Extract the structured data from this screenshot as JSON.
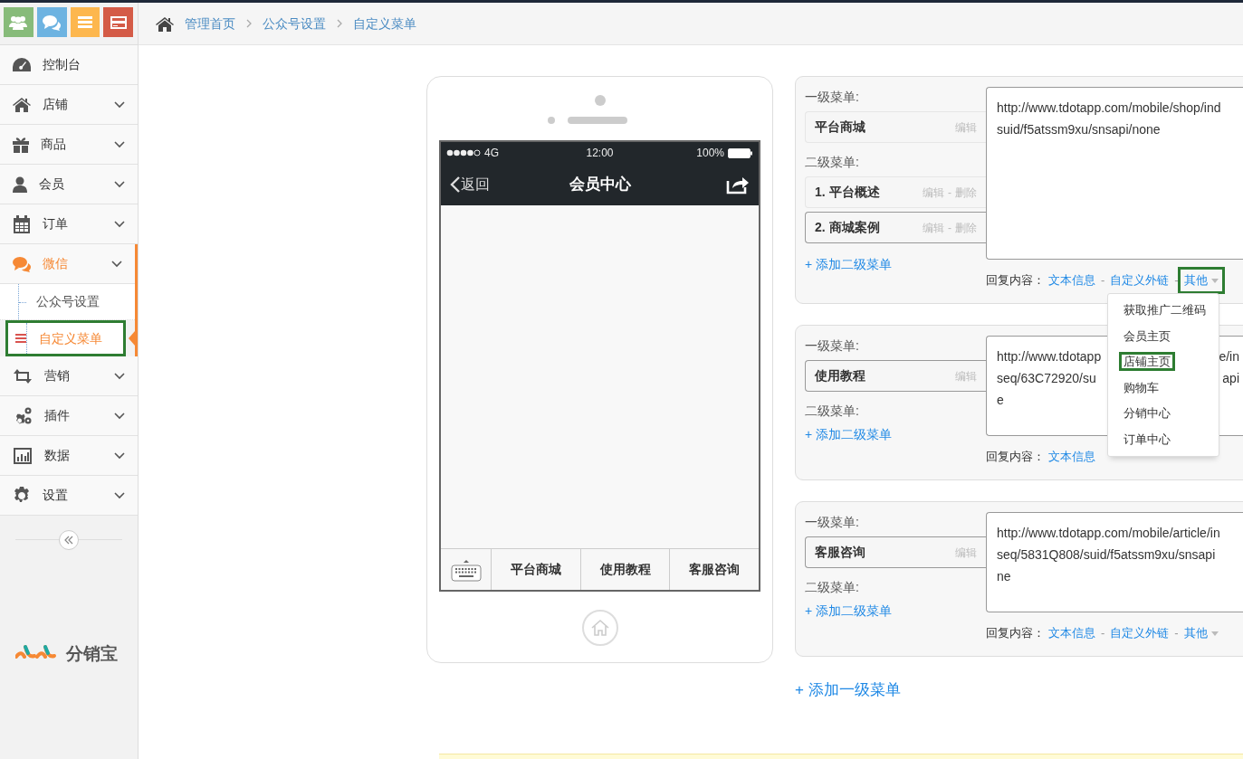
{
  "top_buttons": [
    {
      "color": "#87bb7a"
    },
    {
      "color": "#6db3e1"
    },
    {
      "color": "#fdb74e"
    },
    {
      "color": "#d45b47"
    }
  ],
  "breadcrumb": [
    {
      "label": "管理首页"
    },
    {
      "label": "公众号设置"
    },
    {
      "label": "自定义菜单"
    }
  ],
  "sidebar": {
    "items": [
      {
        "label": "控制台",
        "expandable": false,
        "selected": false
      },
      {
        "label": "店铺",
        "expandable": true,
        "selected": false
      },
      {
        "label": "商品",
        "expandable": true,
        "selected": false
      },
      {
        "label": "会员",
        "expandable": true,
        "selected": false
      },
      {
        "label": "订单",
        "expandable": true,
        "selected": false
      },
      {
        "label": "微信",
        "expandable": true,
        "selected": true,
        "children": [
          {
            "label": "公众号设置",
            "selected": false,
            "highlighted": false
          },
          {
            "label": "自定义菜单",
            "selected": true,
            "highlighted": true
          }
        ]
      },
      {
        "label": "营销",
        "expandable": true,
        "selected": false
      },
      {
        "label": "插件",
        "expandable": true,
        "selected": false
      },
      {
        "label": "数据",
        "expandable": true,
        "selected": false
      },
      {
        "label": "设置",
        "expandable": true,
        "selected": false
      }
    ],
    "brand": "分销宝"
  },
  "phone": {
    "carrier": "4G",
    "time": "12:00",
    "battery": "100%",
    "back": "返回",
    "title": "会员中心",
    "menu": [
      {
        "label": "平台商城"
      },
      {
        "label": "使用教程"
      },
      {
        "label": "客服咨询"
      }
    ]
  },
  "panels": [
    {
      "level1_label": "一级菜单:",
      "level1": {
        "name": "平台商城",
        "edit": "编辑",
        "selected": false
      },
      "level2_label": "二级菜单:",
      "level2": [
        {
          "name": "1. 平台概述",
          "edit": "编辑",
          "separator": "-",
          "delete": "删除",
          "selected": false
        },
        {
          "name": "2. 商城案例",
          "edit": "编辑",
          "separator": "-",
          "delete": "删除",
          "selected": true
        }
      ],
      "add_level2": "+ 添加二级菜单",
      "content": [
        [
          "http://www.tdotapp.com/mobile/shop/ind"
        ],
        [
          "suid/f5atssm9xu/snsapi/none"
        ]
      ],
      "reply_label": "回复内容：",
      "reply_links": [
        {
          "label": "文本信息",
          "caret": false,
          "highlighted": false,
          "separator": "-"
        },
        {
          "label": "自定义外链",
          "caret": false,
          "highlighted": false,
          "separator": "-"
        },
        {
          "label": "其他",
          "caret": true,
          "highlighted": true,
          "open": true
        }
      ],
      "dropdown": [
        {
          "label": "获取推广二维码",
          "highlighted": false
        },
        {
          "label": "会员主页",
          "highlighted": false
        },
        {
          "label": "店铺主页",
          "highlighted": true
        },
        {
          "label": "购物车",
          "highlighted": false
        },
        {
          "label": "分销中心",
          "highlighted": false
        },
        {
          "label": "订单中心",
          "highlighted": false
        }
      ]
    },
    {
      "level1_label": "一级菜单:",
      "level1": {
        "name": "使用教程",
        "edit": "编辑",
        "selected": true
      },
      "level2_label": "二级菜单:",
      "add_level2": "+ 添加二级菜单",
      "content": [
        [
          "http://www.tdotapp",
          "e/in"
        ],
        [
          "seq/63C72920/su",
          "api"
        ],
        [
          "e"
        ]
      ],
      "reply_label": "回复内容：",
      "reply_links": [
        {
          "label": "文本信息",
          "caret": false,
          "highlighted": false
        }
      ]
    },
    {
      "level1_label": "一级菜单:",
      "level1": {
        "name": "客服咨询",
        "edit": "编辑",
        "selected": true
      },
      "level2_label": "二级菜单:",
      "add_level2": "+ 添加二级菜单",
      "content": [
        [
          "http://www.tdotapp.com/mobile/article/in"
        ],
        [
          "seq/5831Q808/suid/f5atssm9xu/snsapi"
        ],
        [
          "ne"
        ]
      ],
      "reply_label": "回复内容：",
      "reply_links": [
        {
          "label": "文本信息",
          "caret": false,
          "highlighted": false,
          "separator": "-"
        },
        {
          "label": "自定义外链",
          "caret": false,
          "highlighted": false,
          "separator": "-"
        },
        {
          "label": "其他",
          "caret": true,
          "highlighted": false
        }
      ]
    }
  ],
  "add_level1": "+ 添加一级菜单"
}
